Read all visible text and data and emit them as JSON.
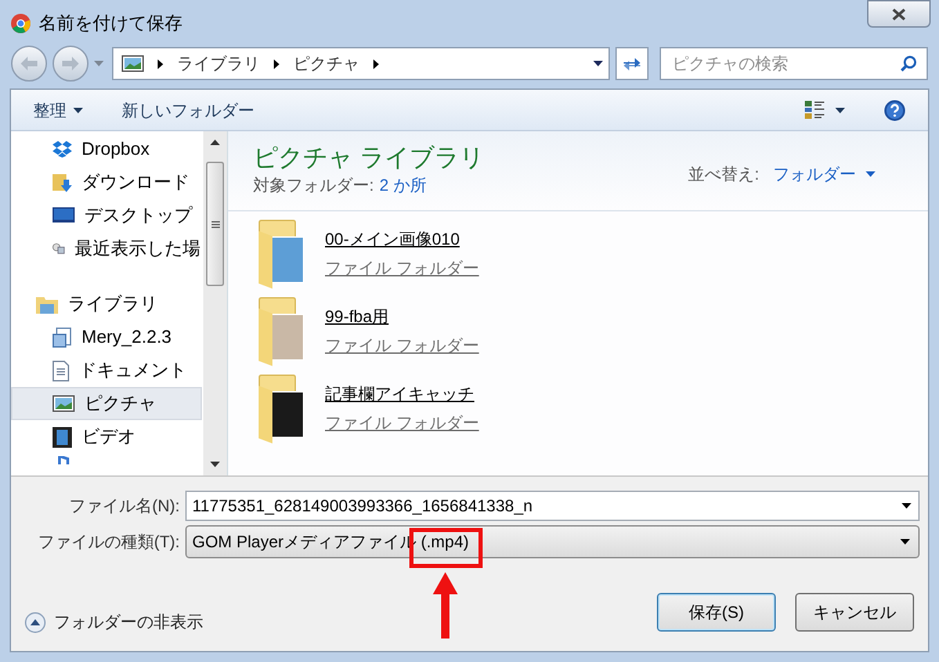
{
  "window": {
    "title": "名前を付けて保存"
  },
  "address": {
    "crumbs": [
      "ライブラリ",
      "ピクチャ"
    ]
  },
  "search": {
    "placeholder": "ピクチャの検索"
  },
  "toolbar": {
    "organize": "整理",
    "new_folder": "新しいフォルダー"
  },
  "nav": {
    "favorites": [
      {
        "label": "Dropbox",
        "kind": "dropbox",
        "selected": false
      },
      {
        "label": "ダウンロード",
        "kind": "download",
        "selected": false
      },
      {
        "label": "デスクトップ",
        "kind": "desktop",
        "selected": false
      },
      {
        "label": "最近表示した場",
        "kind": "recent",
        "selected": false
      }
    ],
    "library": {
      "label": "ライブラリ",
      "children": [
        {
          "label": "Mery_2.2.3",
          "kind": "app",
          "selected": false
        },
        {
          "label": "ドキュメント",
          "kind": "document",
          "selected": false
        },
        {
          "label": "ピクチャ",
          "kind": "picture",
          "selected": true
        },
        {
          "label": "ビデオ",
          "kind": "video",
          "selected": false
        }
      ]
    }
  },
  "library_header": {
    "title": "ピクチャ ライブラリ",
    "includes_label": "対象フォルダー:",
    "includes_link": "2 か所",
    "sort_label": "並べ替え:",
    "sort_value": "フォルダー"
  },
  "folders": [
    {
      "name": "00-メイン画像010",
      "type": "ファイル フォルダー"
    },
    {
      "name": "99-fba用",
      "type": "ファイル フォルダー"
    },
    {
      "name": "記事欄アイキャッチ",
      "type": "ファイル フォルダー"
    }
  ],
  "file_name": {
    "label": "ファイル名(N):",
    "value": "11775351_628149003993366_1656841338_n"
  },
  "file_type": {
    "label": "ファイルの種類(T):",
    "value": "GOM Playerメディアファイル (.mp4)"
  },
  "hide_folders": "フォルダーの非表示",
  "buttons": [
    {
      "label": "保存(S)",
      "kind": "primary"
    },
    {
      "label": "キャンセル",
      "kind": "normal"
    }
  ]
}
